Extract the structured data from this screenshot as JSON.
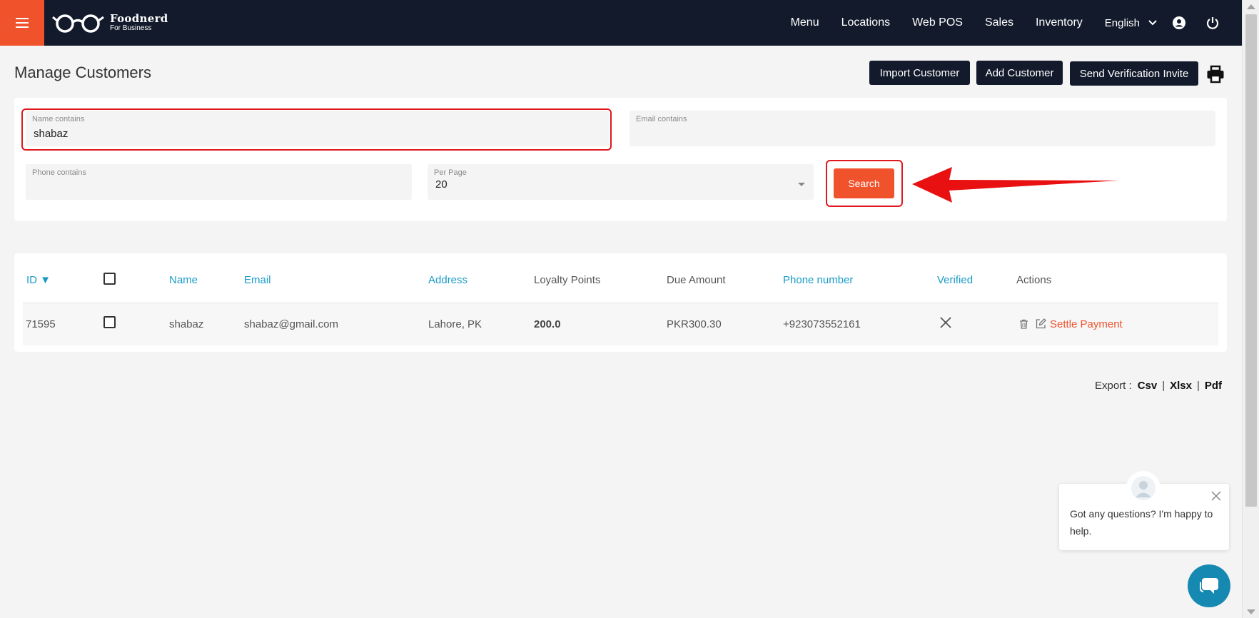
{
  "brand": {
    "name": "Foodnerd",
    "sub": "For Business"
  },
  "nav": {
    "items": [
      "Menu",
      "Locations",
      "Web POS",
      "Sales",
      "Inventory"
    ],
    "language": "English"
  },
  "page": {
    "title": "Manage Customers",
    "buttons": {
      "import": "Import Customer",
      "add": "Add Customer",
      "invite": "Send Verification Invite"
    }
  },
  "filters": {
    "name": {
      "label": "Name contains",
      "value": "shabaz"
    },
    "email": {
      "label": "Email contains",
      "value": ""
    },
    "phone": {
      "label": "Phone contains",
      "value": ""
    },
    "per_page": {
      "label": "Per Page",
      "value": "20"
    },
    "search_label": "Search"
  },
  "table": {
    "headers": {
      "id": "ID ▼",
      "name": "Name",
      "email": "Email",
      "address": "Address",
      "loyalty": "Loyalty Points",
      "due": "Due Amount",
      "phone": "Phone number",
      "verified": "Verified",
      "actions": "Actions"
    },
    "rows": [
      {
        "id": "71595",
        "name": "shabaz",
        "email": "shabaz@gmail.com",
        "address": "Lahore, PK",
        "loyalty": "200.0",
        "due": "PKR300.30",
        "phone": "+923073552161",
        "verified": "x-icon",
        "action_label": "Settle Payment"
      }
    ]
  },
  "export": {
    "label": "Export :",
    "csv": "Csv",
    "xlsx": "Xlsx",
    "pdf": "Pdf"
  },
  "chat": {
    "message": "Got any questions? I'm happy to help."
  },
  "colors": {
    "accent": "#f0522c",
    "navy": "#121a2b",
    "link_blue": "#1a9bc7",
    "highlight_red": "#e0171e",
    "chat_blue": "#1589b1"
  }
}
